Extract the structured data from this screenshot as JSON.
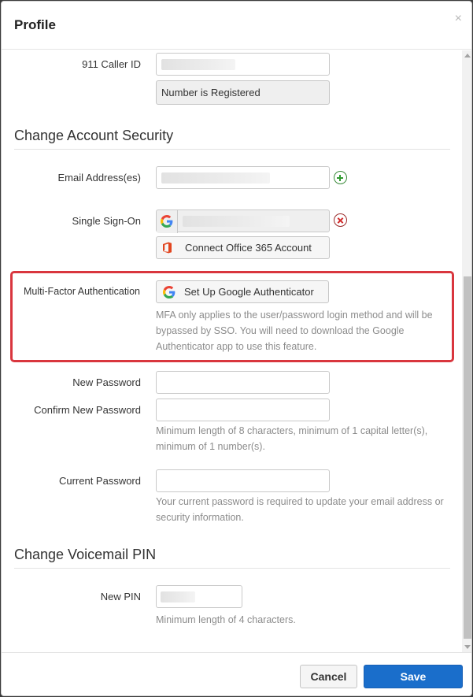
{
  "modal": {
    "title": "Profile",
    "close_glyph": "×"
  },
  "caller_id": {
    "label": "911 Caller ID",
    "status": "Number is Registered"
  },
  "account_security": {
    "title": "Change Account Security",
    "email_label": "Email Address(es)",
    "sso_label": "Single Sign-On",
    "connect_office_label": "Connect Office 365 Account",
    "mfa_label": "Multi-Factor Authentication",
    "mfa_button_label": "Set Up Google Authenticator",
    "mfa_help": "MFA only applies to the user/password login method and will be bypassed by SSO. You will need to download the Google Authenticator app to use this feature.",
    "new_password_label": "New Password",
    "confirm_password_label": "Confirm New Password",
    "password_help": "Minimum length of 8 characters, minimum of 1 capital letter(s), minimum of 1 number(s).",
    "current_password_label": "Current Password",
    "current_password_help": "Your current password is required to update your email address or security information."
  },
  "voicemail": {
    "title": "Change Voicemail PIN",
    "pin_label": "New PIN",
    "pin_help": "Minimum length of 4 characters."
  },
  "footer": {
    "cancel_label": "Cancel",
    "save_label": "Save"
  },
  "colors": {
    "accent": "#1a6ecb",
    "highlight_border": "#d9363e",
    "add_green": "#2e9a2e",
    "remove_red": "#d22b2b",
    "office_orange": "#e2451f"
  },
  "icons": [
    "close-icon",
    "google-icon",
    "office-365-icon",
    "add-icon",
    "remove-icon"
  ]
}
